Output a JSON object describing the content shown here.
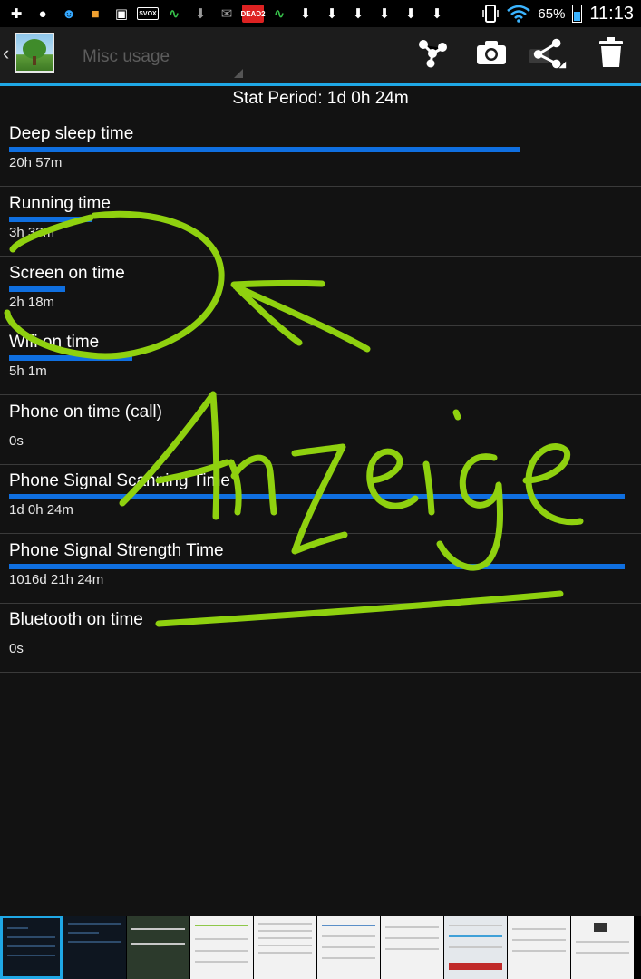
{
  "status_bar": {
    "icons": [
      "plus-icon",
      "piggy-bank-icon",
      "smiley-icon",
      "game-icon",
      "image-icon",
      "svox-icon",
      "activity-icon",
      "download-icon",
      "mail-icon",
      "dead-trigger-icon",
      "activity-icon",
      "download-icon",
      "download-icon",
      "download-icon",
      "download-icon",
      "download-icon",
      "download-icon"
    ],
    "svox_label": "SVOX",
    "dead_label": "DEAD2",
    "battery_percent": "65%",
    "battery_level": 0.65,
    "time": "11:13"
  },
  "action_bar": {
    "spinner_label": "Misc usage",
    "accent_color": "#1fa8e6",
    "actions": [
      "cluster-icon",
      "camera-icon",
      "share-icon",
      "trash-icon"
    ]
  },
  "content": {
    "stat_period": "Stat Period: 1d 0h 24m",
    "bar_color": "#0f6fe0",
    "rows": [
      {
        "title": "Deep sleep time",
        "value": "20h 57m",
        "fraction": 0.83
      },
      {
        "title": "Running time",
        "value": "3h 3?m",
        "fraction": 0.135
      },
      {
        "title": "Screen on time",
        "value": "2h 18m",
        "fraction": 0.092
      },
      {
        "title": "Wifi on time",
        "value": "5h 1m",
        "fraction": 0.2
      },
      {
        "title": "Phone on time (call)",
        "value": "0s",
        "fraction": 0
      },
      {
        "title": "Phone Signal Scanning Time",
        "value": "1d 0h 24m",
        "fraction": 1.0
      },
      {
        "title": "Phone Signal Strength Time",
        "value": "1016d 21h 24m",
        "fraction": 1.0
      },
      {
        "title": "Bluetooth on time",
        "value": "0s",
        "fraction": 0
      }
    ]
  },
  "annotation": {
    "handwriting": "Anzeige",
    "stroke_color": "#8fd10f"
  },
  "thumbnails": {
    "count": 10,
    "selected_index": 0
  }
}
